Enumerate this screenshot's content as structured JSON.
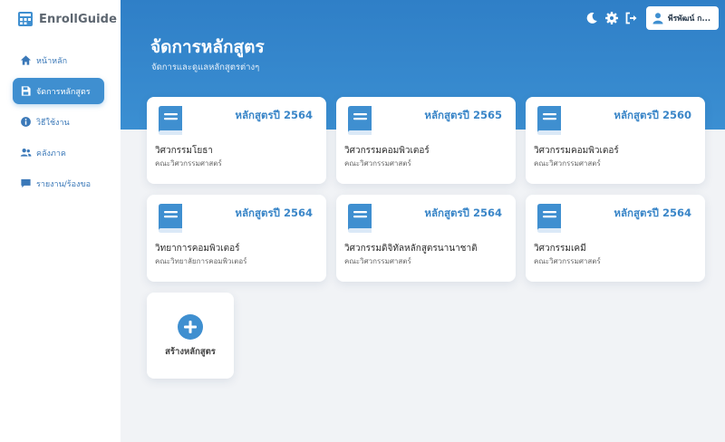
{
  "app": {
    "brand": "EnrollGuide"
  },
  "sidebar": {
    "items": [
      {
        "label": "หน้าหลัก",
        "icon": "home-icon",
        "active": false
      },
      {
        "label": "จัดการหลักสูตร",
        "icon": "save-icon",
        "active": true
      },
      {
        "label": "วิธีใช้งาน",
        "icon": "info-icon",
        "active": false
      },
      {
        "label": "คลังภาค",
        "icon": "users-icon",
        "active": false
      },
      {
        "label": "รายงาน/ร้องขอ",
        "icon": "chat-icon",
        "active": false
      }
    ]
  },
  "header": {
    "title": "จัดการหลักสูตร",
    "subtitle": "จัดการและดูแลหลักสูตรต่างๆ",
    "user_name": "พีรพัฒน์ ก...",
    "icons": [
      "moon-icon",
      "gear-icon",
      "logout-icon",
      "user-icon"
    ]
  },
  "courses": [
    {
      "year": "หลักสูตรปี 2564",
      "name": "วิศวกรรมโยธา",
      "faculty": "คณะวิศวกรรมศาสตร์"
    },
    {
      "year": "หลักสูตรปี 2565",
      "name": "วิศวกรรมคอมพิวเตอร์",
      "faculty": "คณะวิศวกรรมศาสตร์"
    },
    {
      "year": "หลักสูตรปี 2560",
      "name": "วิศวกรรมคอมพิวเตอร์",
      "faculty": "คณะวิศวกรรมศาสตร์"
    },
    {
      "year": "หลักสูตรปี 2564",
      "name": "วิทยาการคอมพิวเตอร์",
      "faculty": "คณะวิทยาลัยการคอมพิวเตอร์"
    },
    {
      "year": "หลักสูตรปี 2564",
      "name": "วิศวกรรมดิจิทัลหลักสูตรนานาชาติ",
      "faculty": "คณะวิศวกรรมศาสตร์"
    },
    {
      "year": "หลักสูตรปี 2564",
      "name": "วิศวกรรมเคมี",
      "faculty": "คณะวิศวกรรมศาสตร์"
    }
  ],
  "create": {
    "label": "สร้างหลักสูตร",
    "icon": "plus-icon"
  },
  "colors": {
    "accent": "#3f8fd0",
    "header_top": "#2f7fc7",
    "header_bottom": "#3b8fd2",
    "year_text": "#3a86c8",
    "sidebar_text": "#3a78b8",
    "background": "#f1f3f6"
  }
}
